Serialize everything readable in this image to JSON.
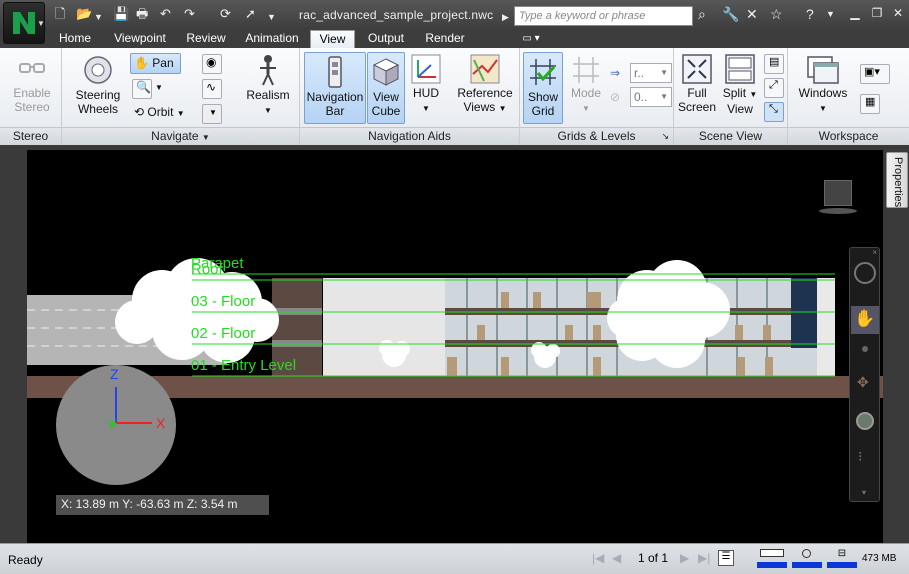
{
  "app": {
    "title": "rac_advanced_sample_project.nwc",
    "search_placeholder": "Type a keyword or phrase"
  },
  "tabs": [
    "Home",
    "Viewpoint",
    "Review",
    "Animation",
    "View",
    "Output",
    "Render"
  ],
  "active_tab": "View",
  "ribbon": {
    "stereo": {
      "title": "Stereo",
      "enable": "Enable",
      "stereo": "Stereo"
    },
    "navigate": {
      "title": "Navigate",
      "steering1": "Steering",
      "steering2": "Wheels",
      "pan": "Pan",
      "orbit": "Orbit",
      "realism": "Realism"
    },
    "navaids": {
      "title": "Navigation Aids",
      "navbar1": "Navigation",
      "navbar2": "Bar",
      "viewcube1": "View",
      "viewcube2": "Cube",
      "hud": "HUD",
      "ref1": "Reference",
      "ref2": "Views"
    },
    "grids": {
      "title": "Grids & Levels",
      "show1": "Show",
      "show2": "Grid",
      "mode": "Mode",
      "sel1": "r..",
      "sel2": "0.."
    },
    "scene": {
      "title": "Scene View",
      "full1": "Full",
      "full2": "Screen",
      "split1": "Split",
      "split2": "View"
    },
    "workspace": {
      "title": "Workspace",
      "windows": "Windows"
    }
  },
  "viewport": {
    "levels": [
      "Parapet",
      "Roof",
      "03 - Floor",
      "02 - Floor",
      "01 - Entry Level"
    ],
    "axes": {
      "z": "Z",
      "y": "Y",
      "x": "X"
    },
    "coords": "X: 13.89 m  Y: -63.63 m  Z: 3.54 m",
    "properties_tab": "Properties"
  },
  "status": {
    "ready": "Ready",
    "page": "1 of 1",
    "memory": "473 MB"
  }
}
